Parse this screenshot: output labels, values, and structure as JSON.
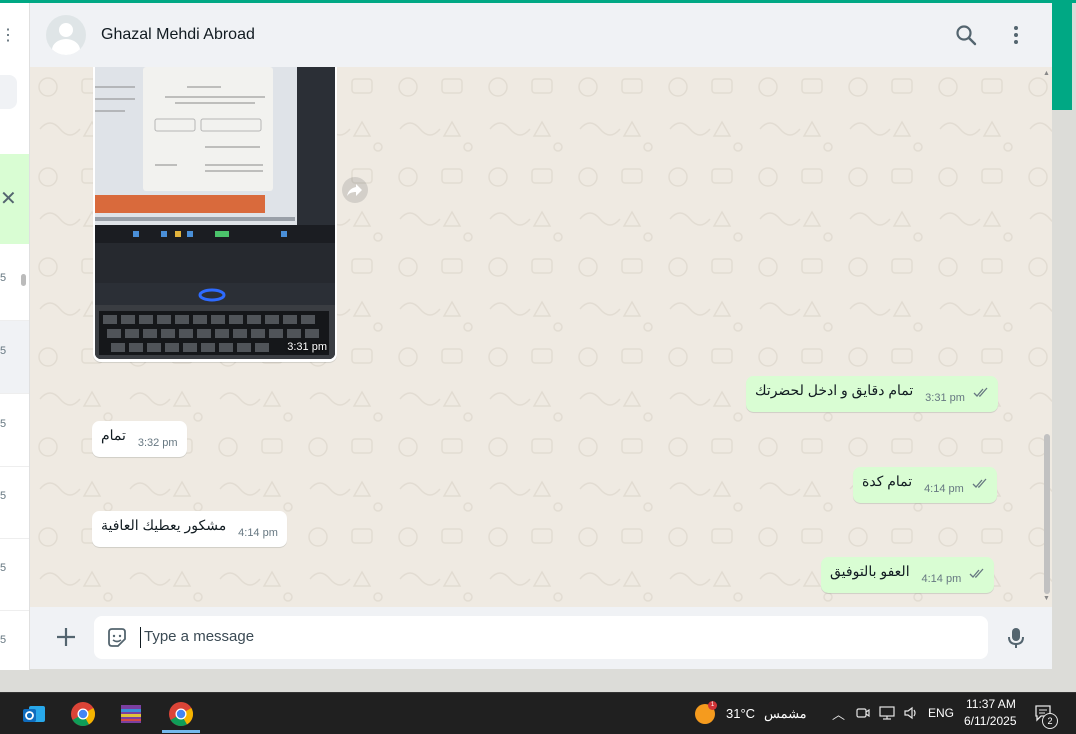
{
  "contact": {
    "name": "Ghazal Mehdi Abroad"
  },
  "image_message": {
    "time": "3:31 pm"
  },
  "messages": [
    {
      "text": "تمام دقايق و ادخل لحضرتك",
      "time": "3:31 pm",
      "direction": "out"
    },
    {
      "text": "تمام",
      "time": "3:32 pm",
      "direction": "in"
    },
    {
      "text": "تمام كدة",
      "time": "4:14 pm",
      "direction": "out"
    },
    {
      "text": "مشكور يعطيك العافية",
      "time": "4:14 pm",
      "direction": "in"
    },
    {
      "text": "العفو بالتوفيق",
      "time": "4:14 pm",
      "direction": "out"
    }
  ],
  "composer": {
    "placeholder": "Type a message"
  },
  "left_list": {
    "row_labels": [
      "5",
      "5",
      "5",
      "5",
      "5",
      "5"
    ]
  },
  "taskbar": {
    "weather_badge": "1",
    "temperature": "31°C",
    "weather_text": "مشمس",
    "language": "ENG",
    "time": "11:37 AM",
    "date": "6/11/2025",
    "notification_count": "2"
  },
  "colors": {
    "accent": "#00a884",
    "outgoing_bubble": "#d9fdd3",
    "incoming_bubble": "#ffffff",
    "chat_background": "#efeae2",
    "read_ticks": "#667781"
  }
}
